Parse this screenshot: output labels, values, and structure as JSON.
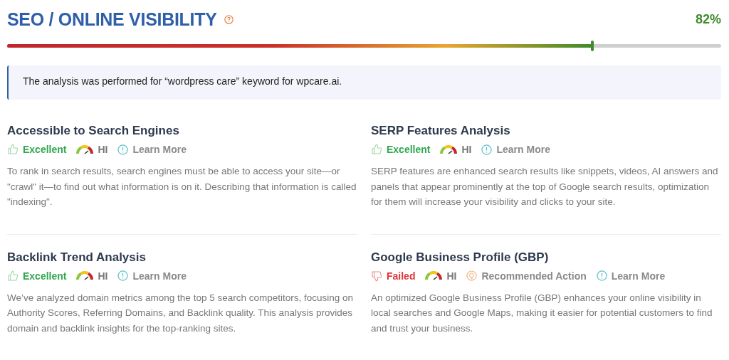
{
  "header": {
    "title": "SEO / ONLINE VISIBILITY",
    "score": "82%",
    "level": 0.82
  },
  "note": {
    "text": "The analysis was performed for “wordpress care” keyword for wpcare.ai."
  },
  "checks": [
    {
      "title": "Accessible to Search Engines",
      "status": {
        "kind": "excellent",
        "label": "Excellent"
      },
      "priority": "HI",
      "actions": [
        {
          "kind": "learn_more",
          "label": "Learn More"
        }
      ],
      "description": "To rank in search results, search engines must be able to access your site—or \"crawl\" it—to find out what information is on it. Describing that information is called \"indexing\"."
    },
    {
      "title": "SERP Features Analysis",
      "status": {
        "kind": "excellent",
        "label": "Excellent"
      },
      "priority": "HI",
      "actions": [
        {
          "kind": "learn_more",
          "label": "Learn More"
        }
      ],
      "description": "SERP features are enhanced search results like snippets, videos, AI answers and panels that appear prominently at the top of Google search results, optimization for them will increase your visibility and clicks to your site."
    },
    {
      "title": "Backlink Trend Analysis",
      "status": {
        "kind": "excellent",
        "label": "Excellent"
      },
      "priority": "HI",
      "actions": [
        {
          "kind": "learn_more",
          "label": "Learn More"
        }
      ],
      "description": "We’ve analyzed domain metrics among the top 5 search competitors, focusing on Authority Scores, Referring Domains, and Backlink quality. This analysis provides domain and backlink insights for the top-ranking sites."
    },
    {
      "title": "Google Business Profile (GBP)",
      "status": {
        "kind": "failed",
        "label": "Failed"
      },
      "priority": "HI",
      "actions": [
        {
          "kind": "recommended",
          "label": "Recommended Action"
        },
        {
          "kind": "learn_more",
          "label": "Learn More"
        }
      ],
      "description": "An optimized Google Business Profile (GBP) enhances your online visibility in local searches and Google Maps, making it easier for potential customers to find and trust your business."
    }
  ]
}
